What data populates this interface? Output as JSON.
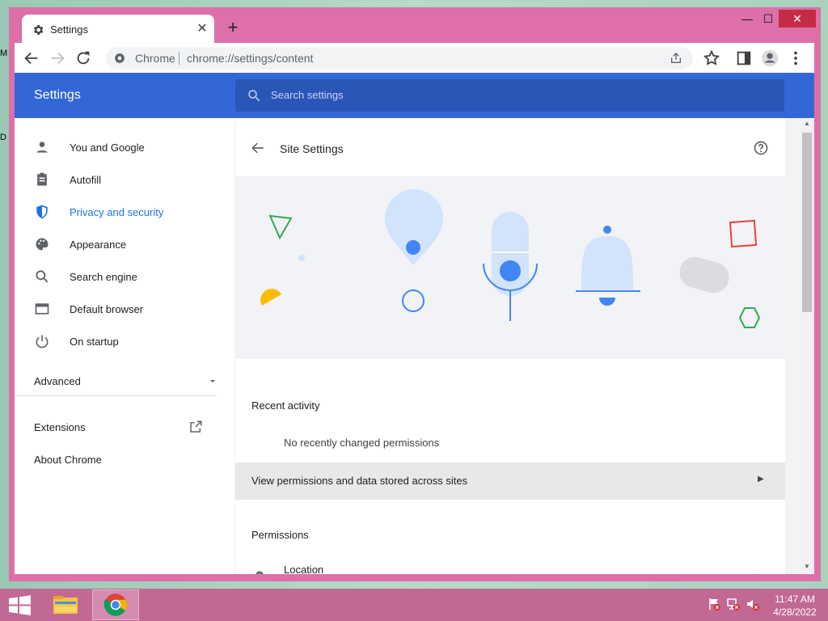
{
  "desktop": {
    "fragments": [
      "M",
      "D"
    ]
  },
  "window_controls": {
    "minimize": "—",
    "maximize": "☐",
    "close": "✕"
  },
  "tab": {
    "title": "Settings",
    "close": "✕",
    "new_tab": "+"
  },
  "omnibox": {
    "site": "Chrome",
    "url": "chrome://settings/content"
  },
  "settings": {
    "title": "Settings",
    "search_placeholder": "Search settings"
  },
  "sidebar": {
    "items": [
      {
        "label": "You and Google",
        "icon": "person-icon"
      },
      {
        "label": "Autofill",
        "icon": "clipboard-icon"
      },
      {
        "label": "Privacy and security",
        "icon": "shield-icon"
      },
      {
        "label": "Appearance",
        "icon": "palette-icon"
      },
      {
        "label": "Search engine",
        "icon": "search-icon"
      },
      {
        "label": "Default browser",
        "icon": "browser-icon"
      },
      {
        "label": "On startup",
        "icon": "power-icon"
      }
    ],
    "advanced": "Advanced",
    "extensions": "Extensions",
    "about": "About Chrome"
  },
  "main": {
    "title": "Site Settings",
    "recent_activity": "Recent activity",
    "no_changes": "No recently changed permissions",
    "view_permissions": "View permissions and data stored across sites",
    "permissions": "Permissions",
    "location": "Location"
  },
  "taskbar": {
    "time": "11:47 AM",
    "date": "4/28/2022"
  },
  "colors": {
    "accent": "#3367d6",
    "active": "#1a73e8",
    "window_frame": "#dd6fa9"
  }
}
